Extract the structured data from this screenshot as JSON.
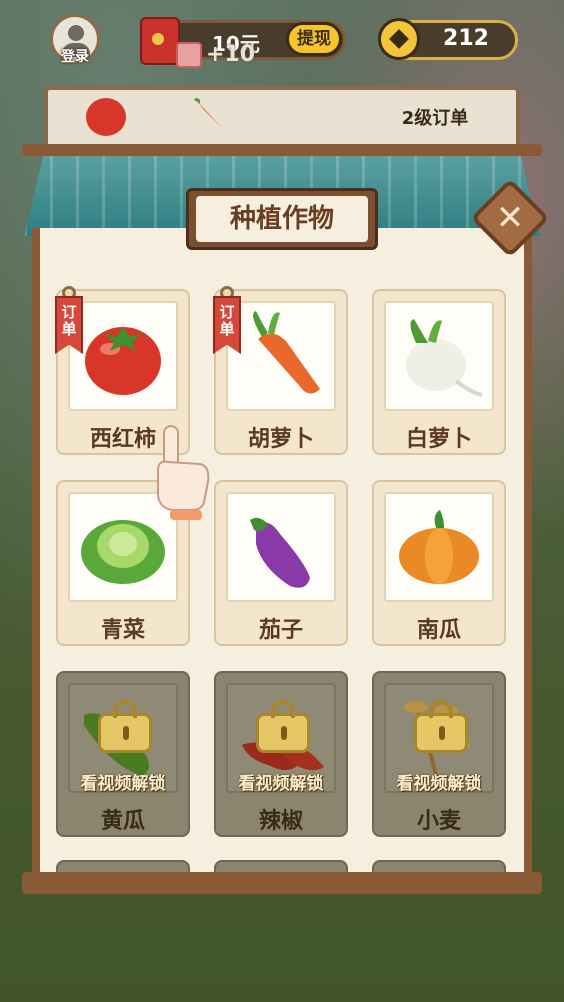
{
  "hud": {
    "login_label": "登录",
    "cash_value": "10元",
    "cash_bonus": "+10",
    "withdraw_label": "提现",
    "coins": "212"
  },
  "order_strip": {
    "level_label": "2级订单"
  },
  "panel": {
    "title": "种植作物",
    "close_symbol": "✕"
  },
  "crops": [
    {
      "name": "西红柿",
      "icon": "tomato-icon",
      "tag": "订单",
      "locked": false
    },
    {
      "name": "胡萝卜",
      "icon": "carrot-icon",
      "tag": "订单",
      "locked": false
    },
    {
      "name": "白萝卜",
      "icon": "radish-icon",
      "tag": "",
      "locked": false
    },
    {
      "name": "青菜",
      "icon": "cabbage-icon",
      "tag": "",
      "locked": false
    },
    {
      "name": "茄子",
      "icon": "eggplant-icon",
      "tag": "",
      "locked": false
    },
    {
      "name": "南瓜",
      "icon": "pumpkin-icon",
      "tag": "",
      "locked": false
    },
    {
      "name": "黄瓜",
      "icon": "cucumber-icon",
      "tag": "",
      "locked": true,
      "unlock_label": "看视频解锁"
    },
    {
      "name": "辣椒",
      "icon": "chili-icon",
      "tag": "",
      "locked": true,
      "unlock_label": "看视频解锁"
    },
    {
      "name": "小麦",
      "icon": "wheat-icon",
      "tag": "",
      "locked": true,
      "unlock_label": "看视频解锁"
    }
  ],
  "colors": {
    "panel_bg": "#f6efdf",
    "wood": "#8a5a36",
    "roof": "#2f7d82",
    "order_tag": "#d7473a",
    "locked_card": "#8b8570"
  }
}
